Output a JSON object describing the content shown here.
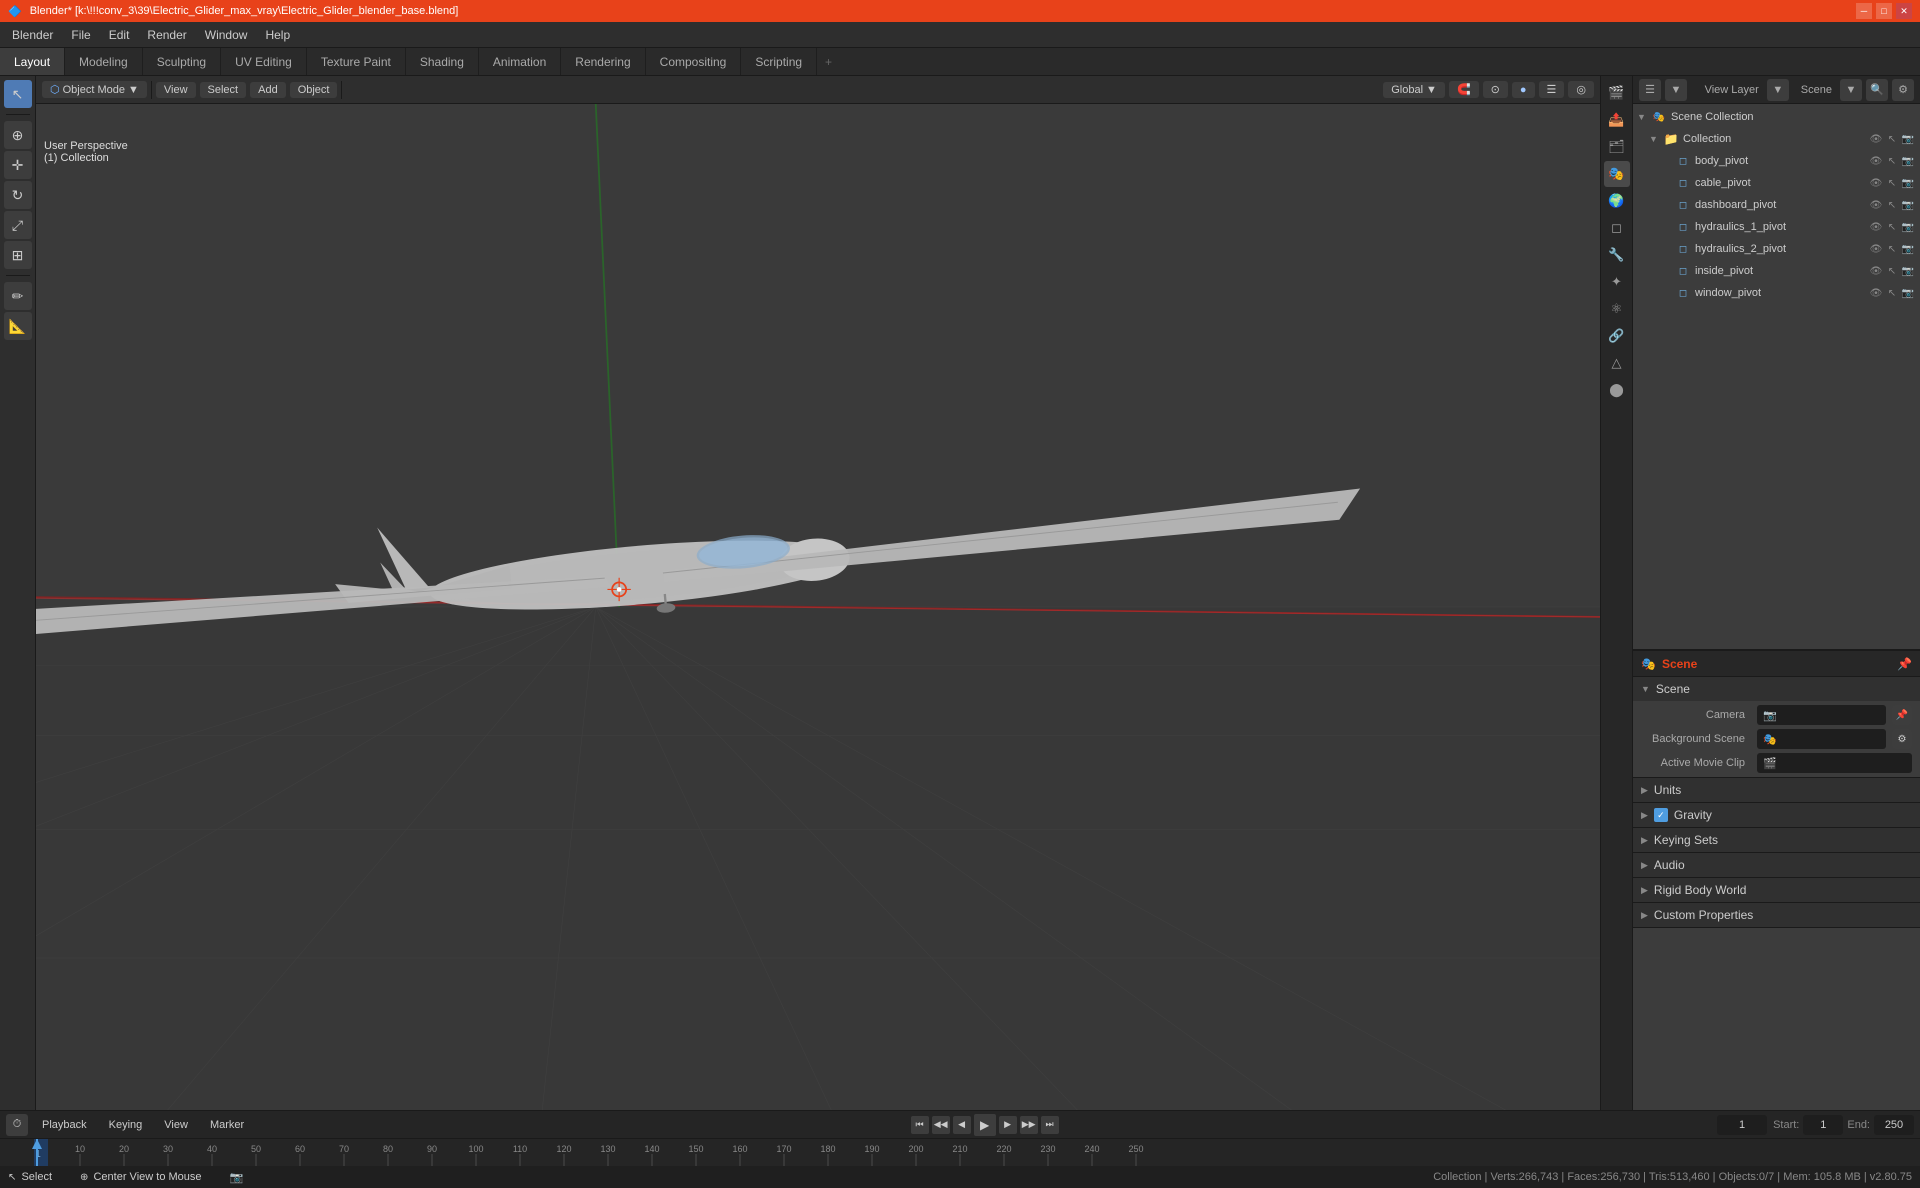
{
  "titleBar": {
    "title": "Blender* [k:\\!!!conv_3\\39\\Electric_Glider_max_vray\\Electric_Glider_blender_base.blend]",
    "logoText": "🔷"
  },
  "menuBar": {
    "items": [
      "Blender",
      "File",
      "Edit",
      "Render",
      "Window",
      "Help"
    ]
  },
  "tabs": {
    "items": [
      "Layout",
      "Modeling",
      "Sculpting",
      "UV Editing",
      "Texture Paint",
      "Shading",
      "Animation",
      "Rendering",
      "Compositing",
      "Scripting"
    ],
    "active": "Layout",
    "plus": "+"
  },
  "viewport": {
    "modeLabel": "Object Mode",
    "viewLabel": "View",
    "selectLabel": "Select",
    "addLabel": "Add",
    "objectLabel": "Object",
    "perspLabel": "User Perspective",
    "collectionLabel": "(1) Collection",
    "transformLabel": "Global",
    "frameIndicator": "1",
    "startFrame": "1",
    "endFrame": "250"
  },
  "outliner": {
    "title": "Scene Collection",
    "items": [
      {
        "name": "Collection",
        "level": 0,
        "type": "collection",
        "eye": true,
        "sel": true,
        "render": true
      },
      {
        "name": "body_pivot",
        "level": 1,
        "type": "object",
        "eye": true,
        "sel": true,
        "render": true
      },
      {
        "name": "cable_pivot",
        "level": 1,
        "type": "object",
        "eye": true,
        "sel": true,
        "render": true
      },
      {
        "name": "dashboard_pivot",
        "level": 1,
        "type": "object",
        "eye": true,
        "sel": true,
        "render": true
      },
      {
        "name": "hydraulics_1_pivot",
        "level": 1,
        "type": "object",
        "eye": true,
        "sel": true,
        "render": true
      },
      {
        "name": "hydraulics_2_pivot",
        "level": 1,
        "type": "object",
        "eye": true,
        "sel": true,
        "render": true
      },
      {
        "name": "inside_pivot",
        "level": 1,
        "type": "object",
        "eye": true,
        "sel": true,
        "render": true
      },
      {
        "name": "window_pivot",
        "level": 1,
        "type": "object",
        "eye": true,
        "sel": true,
        "render": true
      }
    ]
  },
  "sceneProps": {
    "panelTitle": "Scene",
    "sectionTitle": "Scene",
    "camera": "Camera",
    "backgroundScene": "Background Scene",
    "activeMovieClip": "Active Movie Clip",
    "sections": [
      {
        "label": "Units",
        "collapsed": true
      },
      {
        "label": "Gravity",
        "collapsed": false,
        "checked": true
      },
      {
        "label": "Keying Sets",
        "collapsed": true
      },
      {
        "label": "Audio",
        "collapsed": true
      },
      {
        "label": "Rigid Body World",
        "collapsed": true
      },
      {
        "label": "Custom Properties",
        "collapsed": true
      }
    ]
  },
  "rightPanel": {
    "viewLayerLabel": "View Layer",
    "sceneLabel": "Scene"
  },
  "timeline": {
    "playbackLabel": "Playback",
    "keyingLabel": "Keying",
    "viewLabel": "View",
    "markerLabel": "Marker",
    "frameNumbers": [
      "1",
      "10",
      "20",
      "30",
      "40",
      "50",
      "60",
      "70",
      "80",
      "90",
      "100",
      "110",
      "120",
      "130",
      "140",
      "150",
      "160",
      "170",
      "180",
      "190",
      "200",
      "210",
      "220",
      "230",
      "240",
      "250"
    ],
    "currentFrame": "1",
    "startFrame": "1",
    "endFrame": "250"
  },
  "statusBar": {
    "select": "Select",
    "centerView": "Center View to Mouse",
    "stats": "Collection | Verts:266,743 | Faces:256,730 | Tris:513,460 | Objects:0/7 | Mem: 105.8 MB | v2.80.75"
  },
  "colors": {
    "accent": "#e8421a",
    "active": "#4f9de0",
    "bg": "#383838",
    "panel": "#2b2b2b",
    "header": "#272727"
  }
}
